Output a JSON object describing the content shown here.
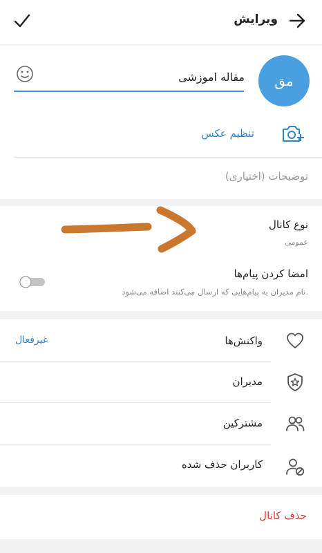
{
  "header": {
    "title": "ویرایش"
  },
  "profile": {
    "avatar_initials": "مق",
    "channel_name": "مقاله اموزشی",
    "set_photo_label": "تنظیم عکس",
    "description_placeholder": "توضیحات (اختیاری)"
  },
  "channel_settings": {
    "type_label": "نوع کانال",
    "type_value": "عمومی",
    "sign_messages_label": "امضا کردن پیام‌ها",
    "sign_messages_desc": "نام مدیران به پیام‌هایی که ارسال می‌کنند اضافه می‌شود.",
    "sign_messages_enabled": false
  },
  "management": {
    "reactions_label": "واکنش‌ها",
    "reactions_value": "غیرفعال",
    "admins_label": "مدیران",
    "subscribers_label": "مشترکین",
    "removed_users_label": "کاربران حذف شده"
  },
  "danger": {
    "delete_channel_label": "حذف کانال"
  },
  "colors": {
    "accent": "#3a95de",
    "avatar": "#4a9fe0",
    "danger": "#d13c3c",
    "annotation_arrow": "#c8772c"
  }
}
